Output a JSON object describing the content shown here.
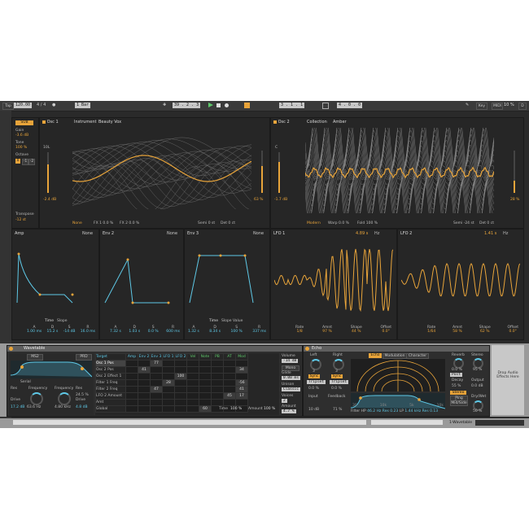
{
  "transport": {
    "tap_label": "Tap",
    "tempo": "120.00",
    "sig_num": "4",
    "sig_den": "4",
    "metro": "●",
    "quant": "1 Bar",
    "position": "39 . 2 . 3",
    "loop_start": "3 . 1 . 1",
    "loop_len": "4 . 0 . 0",
    "key_label": "Key",
    "midi_label": "MIDI",
    "cpu": "10 %",
    "d_label": "D"
  },
  "sub": {
    "label": "SUB",
    "gain_label": "Gain",
    "gain": "-3.6 dB",
    "tone_label": "Tone",
    "tone": "100 %",
    "octave_label": "Octave",
    "oct_opts": [
      "0",
      "-1",
      "-2"
    ],
    "transpose_label": "Transpose",
    "transpose": "-12 st"
  },
  "osc1": {
    "title": "Osc 1",
    "category": "Instrument",
    "wavetable": "Beauty Vox",
    "left_readout": "10L",
    "left_db": "-2.4 dB",
    "right_pct": "63 %",
    "fx_mode": "None",
    "fx1": "FX 1 0.0 %",
    "fx2": "FX 2 0.0 %",
    "semi": "Semi 0 st",
    "det": "Det 0 ct"
  },
  "osc2": {
    "title": "Osc 2",
    "category": "Collection",
    "wavetable": "Amber",
    "left_readout": "C",
    "left_db": "-1.7 dB",
    "right_pct": "28 %",
    "fx_mode": "Modern",
    "warp": "Warp 0.0 %",
    "fold": "Fold 100 %",
    "semi": "Semi -24 st",
    "det": "Det 0 ct"
  },
  "envs": [
    {
      "title": "Amp",
      "mode": "None",
      "params": [
        [
          "A",
          "1.00 ms"
        ],
        [
          "D",
          "15.2 s"
        ],
        [
          "S",
          "-14 dB"
        ],
        [
          "R",
          "16.0 ms"
        ]
      ]
    },
    {
      "title": "Env 2",
      "mode": "None",
      "params": [
        [
          "A",
          "7.32 s"
        ],
        [
          "D",
          "1.03 s"
        ],
        [
          "S",
          "0.0 %"
        ],
        [
          "R",
          "600 ms"
        ]
      ]
    },
    {
      "title": "Env 3",
      "mode": "None",
      "params": [
        [
          "A",
          "1.32 s"
        ],
        [
          "D",
          "8.34 s"
        ],
        [
          "S",
          "100 %"
        ],
        [
          "R",
          "337 ms"
        ]
      ]
    }
  ],
  "env_tabs": [
    "Time",
    "Slope",
    "Value"
  ],
  "lfo1": {
    "title": "LFO 1",
    "rate_head": "4.89 s",
    "hz": "Hz",
    "params": [
      [
        "Rate",
        "1/8"
      ],
      [
        "Amnt",
        "97 %"
      ],
      [
        "Shape",
        "44 %"
      ],
      [
        "Offset",
        "0.0°"
      ]
    ]
  },
  "lfo2": {
    "title": "LFO 2",
    "rate_head": "1.41 s",
    "hz": "Hz",
    "params": [
      [
        "Rate",
        "1/64"
      ],
      [
        "Amnt",
        "58 %"
      ],
      [
        "Shape",
        "62 %"
      ],
      [
        "Offset",
        "0.0°"
      ]
    ]
  },
  "device": {
    "name": "Wavetable",
    "filter1_type": "MS2",
    "filter2_type": "PRD",
    "serial": "Serial",
    "res_label": "Res",
    "freq_label": "Frequency",
    "f1_freq": "63.6 Hz",
    "f1_drive_label": "Drive",
    "f1_drive": "17.2 dB",
    "f2_freq": "4.80 kHz",
    "f2_res": "24.5 %",
    "f2_drive": "4.8 dB"
  },
  "matrix": {
    "headers": [
      "Target",
      "Amp",
      "Env 2",
      "Env 3",
      "LFO 1",
      "LFO 2",
      "Vel",
      "Note",
      "PB",
      "AT",
      "Mod"
    ],
    "rows": [
      {
        "label": "Osc 1 Pos",
        "cells": [
          "",
          "",
          "77",
          "",
          "",
          "",
          "",
          "",
          "",
          ""
        ]
      },
      {
        "label": "Osc 2 Pos",
        "cells": [
          "",
          "41",
          "",
          "",
          "",
          "",
          "",
          "",
          "",
          "34"
        ]
      },
      {
        "label": "Osc 2 Effect 1",
        "cells": [
          "",
          "",
          "",
          "",
          "100",
          "",
          "",
          "",
          "",
          ""
        ]
      },
      {
        "label": "Filter 1 Freq",
        "cells": [
          "",
          "",
          "",
          "28",
          "",
          "",
          "",
          "",
          "",
          "-56"
        ]
      },
      {
        "label": "Filter 2 Freq",
        "cells": [
          "",
          "",
          "47",
          "",
          "",
          "",
          "",
          "",
          "",
          "41"
        ]
      },
      {
        "label": "LFO 2 Amount",
        "cells": [
          "",
          "",
          "",
          "",
          "",
          "",
          "",
          "",
          "45",
          "17"
        ]
      },
      {
        "label": "Amt",
        "cells": [
          "",
          "",
          "",
          "",
          "",
          "",
          "",
          "",
          "",
          ""
        ]
      },
      {
        "label": "Global",
        "cells": [
          "",
          "",
          "",
          "",
          "",
          "",
          "60",
          "",
          "",
          ""
        ]
      }
    ],
    "time_label": "Time",
    "time_val": "100 %",
    "amount_label": "Amount",
    "amount_val": "100 %"
  },
  "voice": {
    "volume_label": "Volume",
    "volume": "-14 dB",
    "mono": "Mono",
    "glide_label": "Glide",
    "glide": "0.00 ms",
    "unison_label": "Unison",
    "unison": "Classic",
    "voices_label": "Voices",
    "voices": "2",
    "amount_label": "Amount",
    "amount": "4.7 %"
  },
  "echo": {
    "name": "Echo",
    "tabs": [
      "Echo",
      "Modulation",
      "Character"
    ],
    "left_label": "Left",
    "right_label": "Right",
    "left_val": "3",
    "right_val": "3",
    "sync": "Sync",
    "triplet": "Triplet",
    "left_pct": "0.0 %",
    "right_pct": "0.0 %",
    "input_label": "Input",
    "input_val": "10 dB",
    "feedback_label": "Feedback",
    "feedback_val": "71 %",
    "filter_hp": "Filter HP",
    "hp_freq": "46.2 Hz",
    "res1": "Res 0.23",
    "lp_label": "LP",
    "lp_freq": "1.44 kHz",
    "res2": "Res 0.13",
    "reverb_label": "Reverb",
    "reverb_val": "0.0 %",
    "stereo_label": "Stereo",
    "stereo_val": "95 %",
    "post": "Post",
    "decay": "Decay",
    "decay_val": "55 %",
    "output_label": "Output",
    "output_val": "0.0 dB",
    "stereo_mode": "Stereo",
    "ping_pong": "Ping Pong",
    "mid_side": "Mid/Side",
    "drywet_label": "Dry/Wet",
    "drywet_val": "50 %",
    "axis": [
      "30",
      "10k",
      "5k",
      "10k"
    ]
  },
  "drop_zone": "Drop Audio Effects Here",
  "status": {
    "track": "1-Wavetable"
  },
  "colors": {
    "accent": "#e8a43a",
    "cyan": "#5ec8e6",
    "panel": "#262626"
  }
}
